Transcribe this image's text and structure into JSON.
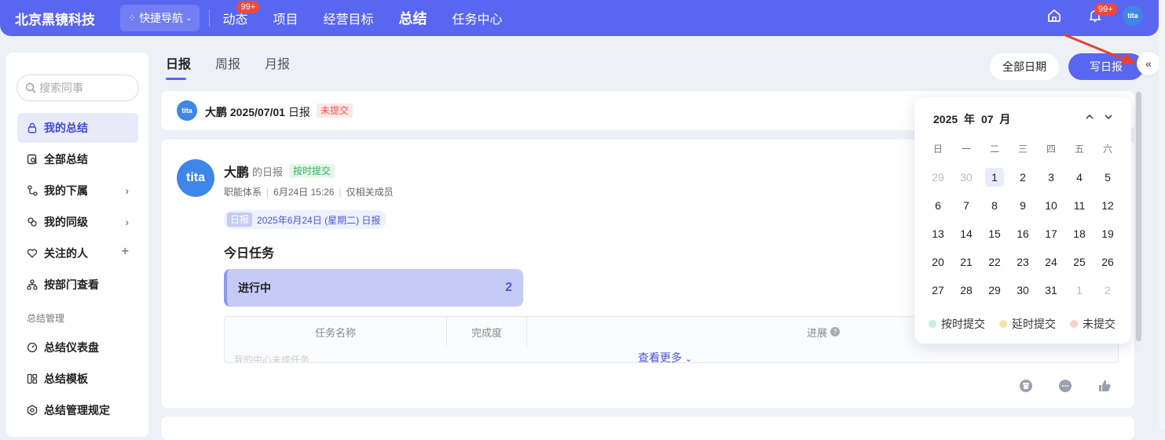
{
  "topbar": {
    "brand": "北京黑镜科技",
    "quicknav": "快捷导航",
    "nav": [
      {
        "label": "动态",
        "badge": "99+"
      },
      {
        "label": "项目"
      },
      {
        "label": "经营目标"
      },
      {
        "label": "总结",
        "active": true
      },
      {
        "label": "任务中心"
      }
    ],
    "bell_badge": "99+",
    "avatar_text": "tita"
  },
  "sidebar": {
    "search_placeholder": "搜索同事",
    "items": [
      {
        "label": "我的总结",
        "icon": "lock-icon",
        "active": true
      },
      {
        "label": "全部总结",
        "icon": "doc-search-icon"
      },
      {
        "label": "我的下属",
        "icon": "branch-icon",
        "trail": "chevron-right-icon"
      },
      {
        "label": "我的同级",
        "icon": "peer-icon",
        "trail": "chevron-right-icon"
      },
      {
        "label": "关注的人",
        "icon": "heart-icon",
        "trail": "plus-icon"
      },
      {
        "label": "按部门查看",
        "icon": "org-icon"
      }
    ],
    "group_label": "总结管理",
    "group_items": [
      {
        "label": "总结仪表盘",
        "icon": "gauge-icon"
      },
      {
        "label": "总结模板",
        "icon": "template-icon"
      },
      {
        "label": "总结管理规定",
        "icon": "rule-icon"
      }
    ]
  },
  "tabs": [
    "日报",
    "周报",
    "月报"
  ],
  "buttons": {
    "all_dates": "全部日期",
    "write": "写日报",
    "collapse": "«"
  },
  "card1": {
    "name": "大鹏",
    "date": "2025/07/01",
    "type": "日报",
    "status": "未提交"
  },
  "card2": {
    "name": "大鹏",
    "suffix": "的日报",
    "status": "按时提交",
    "meta": [
      "职能体系",
      "6月24日 15:26",
      "仅相关成员"
    ],
    "date_tag": "日报",
    "date_text": "2025年6月24日 (星期二) 日报",
    "section_title": "今日任务",
    "progress_label": "进行中",
    "progress_count": "2",
    "columns": [
      "任务名称",
      "完成度",
      "进展"
    ],
    "ghost_row": "我的中心未成任务",
    "see_more": "查看更多"
  },
  "calendar": {
    "year": "2025",
    "year_unit": "年",
    "month": "07",
    "month_unit": "月",
    "weekdays": [
      "日",
      "一",
      "二",
      "三",
      "四",
      "五",
      "六"
    ],
    "weeks": [
      [
        "29",
        "30",
        "1",
        "2",
        "3",
        "4",
        "5"
      ],
      [
        "6",
        "7",
        "8",
        "9",
        "10",
        "11",
        "12"
      ],
      [
        "13",
        "14",
        "15",
        "16",
        "17",
        "18",
        "19"
      ],
      [
        "20",
        "21",
        "22",
        "23",
        "24",
        "25",
        "26"
      ],
      [
        "27",
        "28",
        "29",
        "30",
        "31",
        "1",
        "2"
      ]
    ],
    "legend": [
      {
        "label": "按时提交",
        "color": "#c9efd6"
      },
      {
        "label": "延时提交",
        "color": "#fbe3a6"
      },
      {
        "label": "未提交",
        "color": "#f8cfcf"
      }
    ]
  },
  "colors": {
    "accent": "#5966f0",
    "badge": "#f5463c",
    "arrow": "#e8412f"
  }
}
